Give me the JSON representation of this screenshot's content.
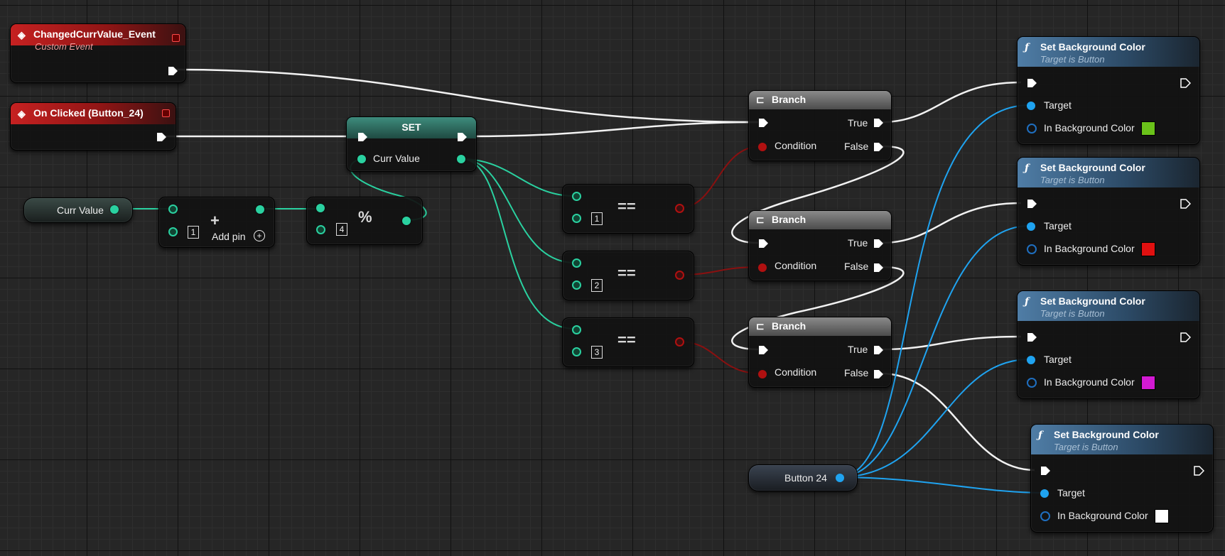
{
  "events": {
    "changed_title": "ChangedCurrValue_Event",
    "changed_subtitle": "Custom Event",
    "clicked_title": "On Clicked (Button_24)"
  },
  "set_node": {
    "title": "SET",
    "var_label": "Curr Value"
  },
  "get_var": {
    "label": "Curr Value"
  },
  "add_node": {
    "op": "+",
    "pin_value": "1",
    "add_pin": "Add pin"
  },
  "mod_node": {
    "op": "%",
    "pin_value": "4"
  },
  "equals": [
    {
      "op": "==",
      "value": "1"
    },
    {
      "op": "==",
      "value": "2"
    },
    {
      "op": "==",
      "value": "3"
    }
  ],
  "branches": [
    {
      "title": "Branch",
      "true_label": "True",
      "false_label": "False",
      "condition_label": "Condition"
    },
    {
      "title": "Branch",
      "true_label": "True",
      "false_label": "False",
      "condition_label": "Condition"
    },
    {
      "title": "Branch",
      "true_label": "True",
      "false_label": "False",
      "condition_label": "Condition"
    }
  ],
  "set_bg": [
    {
      "title": "Set Background Color",
      "subtitle": "Target is Button",
      "target_label": "Target",
      "color_label": "In Background Color",
      "color": "#6ac21a"
    },
    {
      "title": "Set Background Color",
      "subtitle": "Target is Button",
      "target_label": "Target",
      "color_label": "In Background Color",
      "color": "#e01010"
    },
    {
      "title": "Set Background Color",
      "subtitle": "Target is Button",
      "target_label": "Target",
      "color_label": "In Background Color",
      "color": "#d21ad2"
    },
    {
      "title": "Set Background Color",
      "subtitle": "Target is Button",
      "target_label": "Target",
      "color_label": "In Background Color",
      "color": "#ffffff"
    }
  ],
  "button_var": {
    "label": "Button 24"
  },
  "colors": {
    "exec": "#ffffff",
    "int": "#2ad1a0",
    "bool": "#b01010",
    "object": "#1fa3f0"
  },
  "icons": {
    "event": "diamond-event-icon",
    "branch": "branch-icon",
    "function": "function-f-icon"
  }
}
